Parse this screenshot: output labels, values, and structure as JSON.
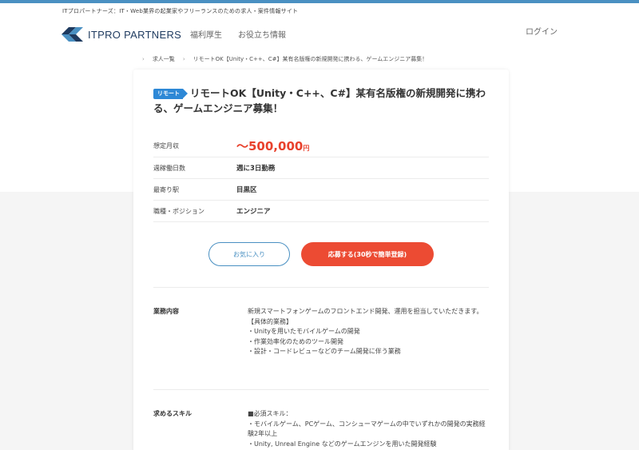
{
  "header": {
    "tagline": "ITプロパートナーズ：IT・Web業界の起業家やフリーランスのための求人・案件情報サイト",
    "logo_text": "ITPRO PARTNERS",
    "nav": [
      "福利厚生",
      "お役立ち情報"
    ],
    "login": "ログイン"
  },
  "breadcrumb": {
    "items": [
      "求人一覧",
      "リモートOK【Unity・C++、C#】某有名版権の新規開発に携わる、ゲームエンジニア募集！"
    ]
  },
  "job": {
    "badge": "リモート",
    "title": "リモートOK【Unity・C++、C#】某有名版権の新規開発に携わる、ゲームエンジニア募集！",
    "info": [
      {
        "label": "想定月収",
        "value": "〜500,000",
        "unit": "円"
      },
      {
        "label": "週稼働日数",
        "value": "週に3日勤務"
      },
      {
        "label": "最寄り駅",
        "value": "目黒区"
      },
      {
        "label": "職種・ポジション",
        "value": "エンジニア"
      }
    ],
    "favorite_label": "お気に入り",
    "apply_label": "応募する(30秒で簡単登録)",
    "sections": [
      {
        "label": "業務内容",
        "body": "新規スマートフォンゲームのフロントエンド開発、運用を担当していただきます。\n【具体的業務】\n・Unityを用いたモバイルゲームの開発\n・作業効率化のためのツール開発\n・設計・コードレビューなどのチーム開発に伴う業務"
      },
      {
        "label": "求めるスキル",
        "body": "■必須スキル：\n・モバイルゲーム、PCゲーム、コンシューマゲームの中でいずれかの開発の実務経験2年以上\n・Unity, Unreal Engine などのゲームエンジンを用いた開発経験"
      }
    ]
  },
  "colors": {
    "accent": "#4a90c2",
    "apply": "#ec4b33",
    "badge": "#2d88d6",
    "salary": "#e8412c"
  }
}
